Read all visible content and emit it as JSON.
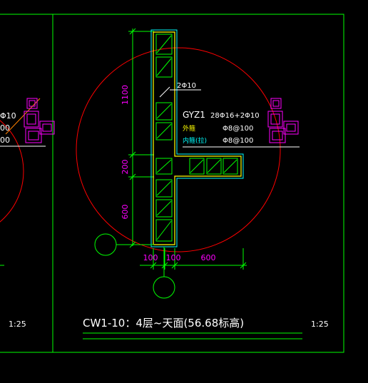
{
  "colors": {
    "background": "#000000",
    "frame": "#00ff00",
    "column_outline": "#ffff00",
    "wall_outline": "#00ffff",
    "hatch": "#00ff00",
    "dimension_text": "#ff00ff",
    "circle": "#ff0000",
    "white_text": "#ffffff",
    "text_yellow": "#ffff00",
    "text_cyan": "#00ffff",
    "bubble": "#00ff00",
    "leader": "#ff8000"
  },
  "section": {
    "id": "GYZ1",
    "main_rebar": "28Φ16+2Φ10",
    "stirrup_label": "外箍",
    "stirrup_value": "Φ8@100",
    "tie_label": "内箍(拉)",
    "tie_value": "Φ8@100",
    "callout_rebar": "2Φ10"
  },
  "dimensions": {
    "vertical": [
      "1100",
      "200",
      "600"
    ],
    "horizontal": [
      "100",
      "100",
      "600"
    ]
  },
  "left_panel": {
    "label_1": "Φ10",
    "label_2": "00",
    "label_3": "00",
    "scale": "1:25"
  },
  "title_block": {
    "title": "CW1-10：4层~天面(56.68标高)",
    "scale": "1:25"
  }
}
